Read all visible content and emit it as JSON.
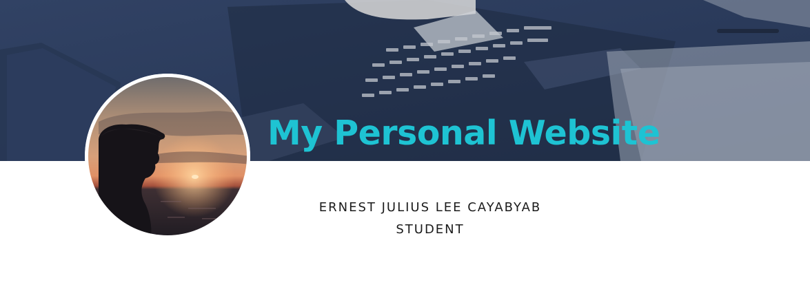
{
  "hero": {
    "title": "My Personal Website",
    "overlay_color": "#2b3b5b",
    "title_color": "#1ec3d3",
    "image": "desk-keyboard-photo"
  },
  "profile": {
    "avatar": "sunset-silhouette-photo",
    "name": "ERNEST JULIUS LEE CAYABYAB",
    "role": "STUDENT",
    "text_color": "#1b1b1b"
  }
}
